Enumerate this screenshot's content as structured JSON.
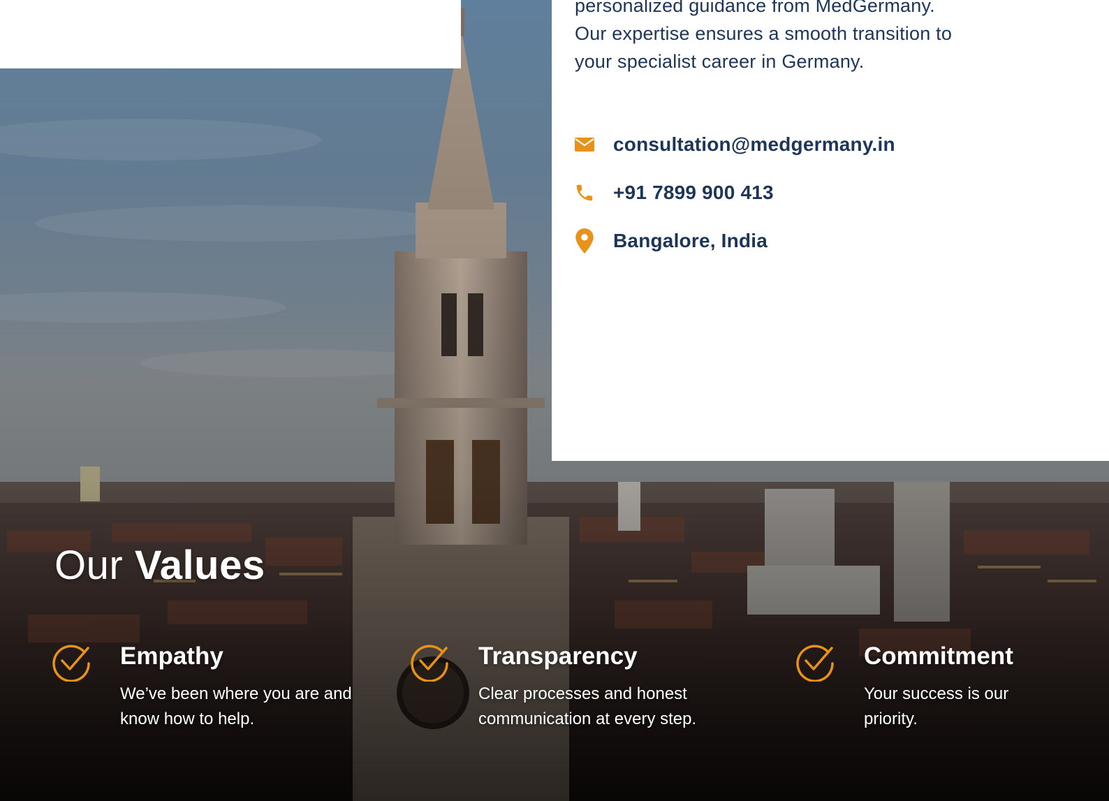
{
  "intro": {
    "line1": "personalized guidance from MedGermany.",
    "line2": "Our expertise ensures a smooth transition to",
    "line3": "your specialist career in Germany."
  },
  "contact": {
    "email": "consultation@medgermany.in",
    "phone": "+91 7899 900 413",
    "location": "Bangalore, India",
    "icons": [
      "mail-icon",
      "phone-icon",
      "location-pin-icon"
    ],
    "accent_color": "#e8921a"
  },
  "values": {
    "title_light": "Our",
    "title_bold": "Values",
    "items": [
      {
        "heading": "Empathy",
        "description": "We’ve been where you are and know how to help.",
        "icon": "check-circle-icon"
      },
      {
        "heading": "Transparency",
        "description": "Clear processes and honest communication at every step.",
        "icon": "check-circle-icon"
      },
      {
        "heading": "Commitment",
        "description": "Your success is our priority.",
        "icon": "check-circle-icon"
      }
    ]
  },
  "colors": {
    "text_dark": "#1d3557",
    "accent": "#e8921a",
    "text_light": "#ffffff"
  }
}
